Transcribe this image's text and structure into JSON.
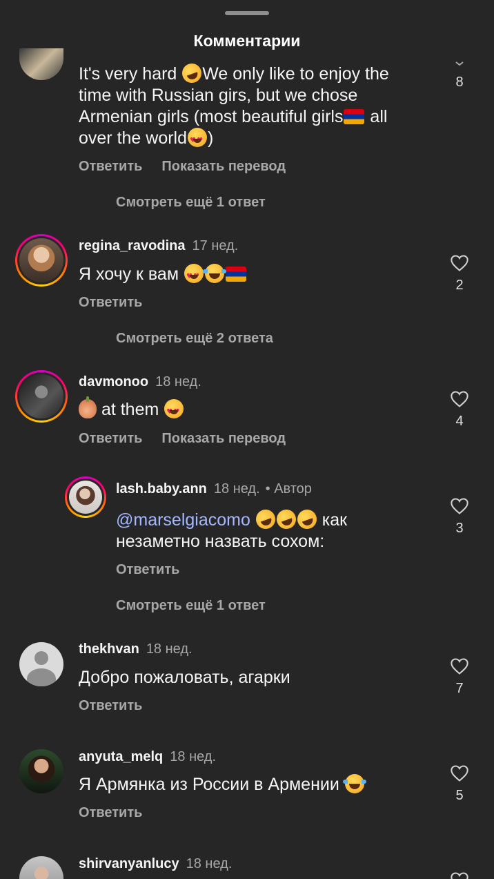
{
  "sheet": {
    "title": "Комментарии"
  },
  "top_comment": {
    "text": "It's very hard 🤣We only like to enjoy the time with Russian girs, but we chose Armenian girls (most beautiful girls🇦🇲 all over the world😍)",
    "text_parts": [
      "It's very hard ",
      "We only like to enjoy the",
      "time with Russian girs, but we chose",
      "Armenian girls (most beautiful girls",
      " all",
      "over the world",
      ")"
    ],
    "reply_label": "Ответить",
    "translate_label": "Показать перевод",
    "like_count": "8",
    "more_replies": "Смотреть ещё 1 ответ"
  },
  "comments": [
    {
      "username": "regina_ravodina",
      "time": "17 нед.",
      "text": "Я хочу к вам 😍😂🇦🇲",
      "text_plain": "Я хочу к вам ",
      "reply_label": "Ответить",
      "like_count": "2",
      "more_replies": "Смотреть ещё 2 ответа"
    },
    {
      "username": "davmonoo",
      "time": "18 нед.",
      "text": "🧅 at them 😍",
      "text_plain": " at them ",
      "reply_label": "Ответить",
      "translate_label": "Показать перевод",
      "like_count": "4"
    },
    {
      "username": "lash.baby.ann",
      "time": "18 нед.",
      "author_badge": "• Автор",
      "mention": "@marselgiacomo",
      "text": "@marselgiacomo 🤣🤣🤣 как незаметно назвать сохом:",
      "text_line1_tail": " как",
      "text_line2": "незаметно назвать сохом:",
      "reply_label": "Ответить",
      "like_count": "3",
      "more_replies": "Смотреть ещё 1 ответ"
    },
    {
      "username": "thekhvan",
      "time": "18 нед.",
      "text": "Добро пожаловать, агарки",
      "reply_label": "Ответить",
      "like_count": "7"
    },
    {
      "username": "anyuta_melq",
      "time": "18 нед.",
      "text": "Я Армянка из России в Армении 😂",
      "text_plain": "Я Армянка из России в Армении ",
      "reply_label": "Ответить",
      "like_count": "5"
    },
    {
      "username": "shirvanyanlucy",
      "time": "18 нед."
    }
  ],
  "icons": {
    "like": "heart-outline-icon",
    "collapse": "chevron-down-icon"
  },
  "colors": {
    "background": "#262626",
    "secondary_text": "#a8a8a8",
    "mention": "#a5b8ff"
  }
}
